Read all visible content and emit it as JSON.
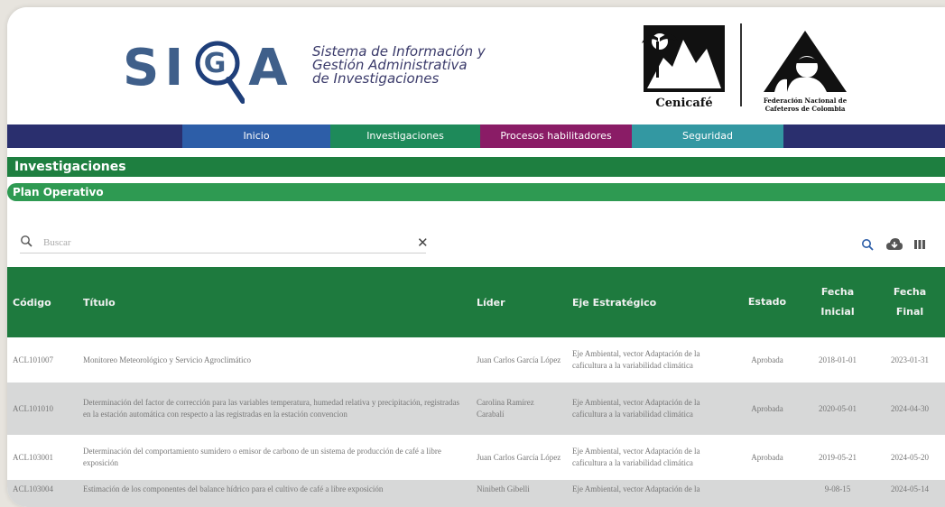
{
  "header": {
    "logo_letters": [
      "S",
      "I",
      "G",
      "A"
    ],
    "tagline": [
      "Sistema de Información y",
      "Gestión Administrativa",
      "de Investigaciones"
    ],
    "partner_left": "Cenicafé",
    "partner_right": [
      "Federación Nacional de",
      "Cafeteros de Colombia"
    ]
  },
  "nav": {
    "items": [
      "Inicio",
      "Investigaciones",
      "Procesos habilitadores",
      "Seguridad"
    ]
  },
  "section": {
    "title": "Investigaciones",
    "subtitle": "Plan Operativo"
  },
  "search": {
    "placeholder": "Buscar",
    "value": ""
  },
  "toolbar": {
    "icons": [
      "search-icon",
      "cloud-download-icon",
      "columns-icon"
    ]
  },
  "table": {
    "columns": [
      "Código",
      "Título",
      "Líder",
      "Eje Estratégico",
      "Estado",
      "Fecha Inicial",
      "Fecha Final"
    ],
    "rows": [
      {
        "codigo": "ACL101007",
        "titulo": "Monitoreo Meteorológico y Servicio Agroclimático",
        "lider": "Juan Carlos García López",
        "eje": "Eje Ambiental, vector Adaptación de la caficultura a la variabilidad climática",
        "estado": "Aprobada",
        "inicial": "2018-01-01",
        "final": "2023-01-31"
      },
      {
        "codigo": "ACL101010",
        "titulo": "Determinación del factor de corrección para las variables temperatura, humedad relativa y precipitación, registradas en la estación automática con respecto a las registradas en la estación convencion",
        "lider": "Carolina Ramírez Carabalí",
        "eje": "Eje Ambiental, vector Adaptación de la caficultura a la variabilidad climática",
        "estado": "Aprobada",
        "inicial": "2020-05-01",
        "final": "2024-04-30"
      },
      {
        "codigo": "ACL103001",
        "titulo": "Determinación del comportamiento sumidero o emisor de carbono de un sistema de producción de café a libre exposición",
        "lider": "Juan Carlos García López",
        "eje": "Eje Ambiental, vector Adaptación de la caficultura a la variabilidad climática",
        "estado": "Aprobada",
        "inicial": "2019-05-21",
        "final": "2024-05-20"
      },
      {
        "codigo": "ACL103004",
        "titulo": "Estimación de los componentes del balance hídrico para el cultivo de café a libre exposición",
        "lider": "Ninibeth Gibelli",
        "eje": "Eje Ambiental, vector Adaptación de la",
        "estado": "",
        "inicial": "9-08-15",
        "final": "2024-05-14"
      }
    ]
  },
  "colors": {
    "nav_bg": "#2a2f6e",
    "inicio": "#2d5ea8",
    "investigaciones": "#1e8a5a",
    "procesos": "#8a1c66",
    "seguridad": "#3398a2",
    "section": "#1e7f40",
    "table_header": "#1e7a3e",
    "logo_blue": "#3f5f8a"
  }
}
